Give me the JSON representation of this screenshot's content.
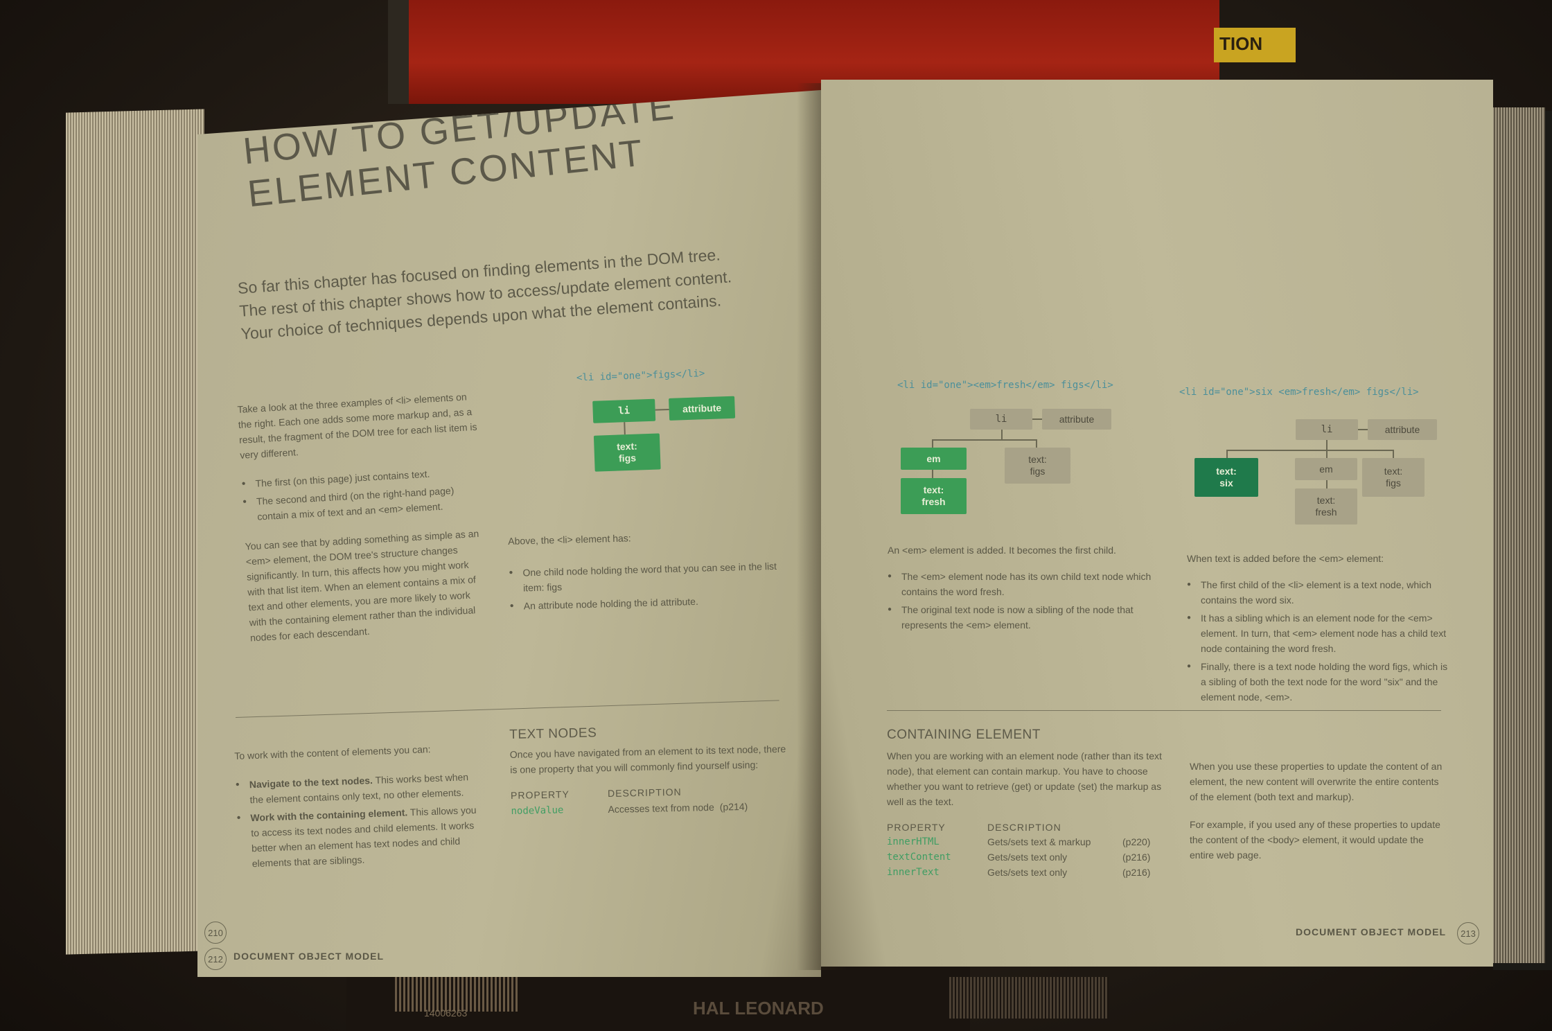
{
  "background": {
    "tag_text": "TION",
    "barcode_number": "14006263",
    "publisher_text": "HAL LEONARD"
  },
  "left_page": {
    "title_line1": "HOW TO GET/UPDATE",
    "title_line2": "ELEMENT CONTENT",
    "intro": [
      "So far this chapter has focused on finding elements in the DOM tree.",
      "The rest of this chapter shows how to access/update element content.",
      "Your choice of techniques depends upon what the element contains."
    ],
    "explain_p1": "Take a look at the three examples of <li> elements on the right. Each one adds some more markup and, as a result, the fragment of the DOM tree for each list item is very different.",
    "explain_bullets": [
      "The first (on this page) just contains text.",
      "The second and third (on the right-hand page) contain a mix of text and an <em> element."
    ],
    "explain_p2": "You can see that by adding something as simple as an <em> element, the DOM tree's structure changes significantly. In turn, this affects how you might work with that list item. When an element contains a mix of text and other elements, you are more likely to work with the containing element rather than the individual nodes for each descendant.",
    "diagram_code": "<li id=\"one\">figs</li>",
    "diagram_nodes": {
      "li": "li",
      "attribute": "attribute",
      "text_line1": "text:",
      "text_line2": "figs"
    },
    "above_label": "Above, the <li> element has:",
    "above_bullets": [
      "One child node holding the word that you can see in the list item: figs",
      "An attribute node holding the id attribute."
    ],
    "work_intro": "To work with the content of elements you can:",
    "work_bullets": [
      {
        "bold": "Navigate to the text nodes.",
        "rest": " This works best when the element contains only text, no other elements."
      },
      {
        "bold": "Work with the containing element.",
        "rest": " This allows you to access its text nodes and child elements. It works better when an element has text nodes and child elements that are siblings."
      }
    ],
    "text_nodes_heading": "TEXT NODES",
    "text_nodes_body": "Once you have navigated from an element to its text node, there is one property that you will commonly find yourself using:",
    "property_header": "PROPERTY",
    "description_header": "DESCRIPTION",
    "properties": [
      {
        "name": "nodeValue",
        "desc": "Accesses text from node",
        "ref": "(p214)"
      }
    ],
    "footer_label": "DOCUMENT OBJECT MODEL",
    "page_number": "212",
    "under_page_number": "210"
  },
  "right_page": {
    "example2_code": "<li id=\"one\"><em>fresh</em> figs</li>",
    "example2_nodes": {
      "li": "li",
      "attribute": "attribute",
      "em": "em",
      "text_figs": "text:\nfigs",
      "text_fresh": "text:\nfresh"
    },
    "example2_caption": "An <em> element is added. It becomes the first child.",
    "example2_bullets": [
      "The <em> element node has its own child text node which contains the word fresh.",
      "The original text node is now a sibling of the node that represents the <em> element."
    ],
    "example3_code": "<li id=\"one\">six <em>fresh</em> figs</li>",
    "example3_nodes": {
      "li": "li",
      "attribute": "attribute",
      "text_six": "text:\nsix",
      "em": "em",
      "text_figs": "text:\nfigs",
      "text_fresh": "text:\nfresh"
    },
    "example3_caption": "When text is added before the <em> element:",
    "example3_bullets": [
      "The first child of the <li> element is a text node, which contains the word six.",
      "It has a sibling which is an element node for the <em> element. In turn, that <em> element node has a child text node containing the word fresh.",
      "Finally, there is a text node holding the word figs, which is a sibling of both the text node for the word \"six\" and the element node, <em>."
    ],
    "containing_heading": "CONTAINING ELEMENT",
    "containing_body": "When you are working with an element node (rather than its text node), that element can contain markup. You have to choose whether you want to retrieve (get) or update (set) the markup as well as the text.",
    "property_header": "PROPERTY",
    "description_header": "DESCRIPTION",
    "properties": [
      {
        "name": "innerHTML",
        "desc": "Gets/sets text & markup",
        "ref": "(p220)"
      },
      {
        "name": "textContent",
        "desc": "Gets/sets text only",
        "ref": "(p216)"
      },
      {
        "name": "innerText",
        "desc": "Gets/sets text only",
        "ref": "(p216)"
      }
    ],
    "update_p1": "When you use these properties to update the content of an element, the new content will overwrite the entire contents of the element (both text and markup).",
    "update_p2": "For example, if you used any of these properties to update the content of the <body> element, it would update the entire web page.",
    "footer_label": "DOCUMENT OBJECT MODEL",
    "page_number": "213"
  },
  "colors": {
    "node_green": "#3c9d56",
    "node_dark_green": "#1f7a4b",
    "node_grey": "#a8a288",
    "code_teal": "#4b8f9a",
    "property_green": "#3f9d63"
  }
}
